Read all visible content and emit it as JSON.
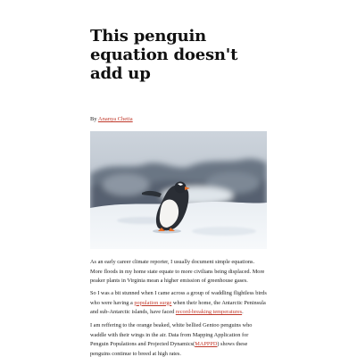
{
  "article": {
    "title": "This penguin equation doesn't add up",
    "byline": {
      "prefix": "By",
      "author": "Ananya Chetia"
    },
    "image": {
      "subject": "Gentoo penguin walking on snow"
    },
    "paragraphs": [
      {
        "segments": [
          {
            "text": "As an early career climate reporter, I usually document simple equations. More floods in my home state equate to more civilians being displaced. More peaker plants in Virginia mean a higher emission of greenhouse gases.",
            "link": false
          }
        ]
      },
      {
        "segments": [
          {
            "text": "So I was a bit stunned when I came across a group of waddling flightless birds who were having a ",
            "link": false
          },
          {
            "text": "population surge",
            "link": true
          },
          {
            "text": " when their home, the Antarctic Peninsula and sub-Antarctic islands, have faced ",
            "link": false
          },
          {
            "text": "record-breaking temperatures",
            "link": true
          },
          {
            "text": ".",
            "link": false
          }
        ]
      },
      {
        "segments": [
          {
            "text": "I am reffering to the orange beaked, white bellied Gentoo penguins who waddle with their wings in the air. Data from Mapping Application for Penguin Populations and Projected Dynamics(",
            "link": false
          },
          {
            "text": "MAPPPD",
            "link": true
          },
          {
            "text": ") shows these penguins continue to breed at high rates.",
            "link": false
          }
        ]
      }
    ]
  },
  "colors": {
    "link": "#c0392b",
    "text": "#222222",
    "title": "#111111"
  }
}
